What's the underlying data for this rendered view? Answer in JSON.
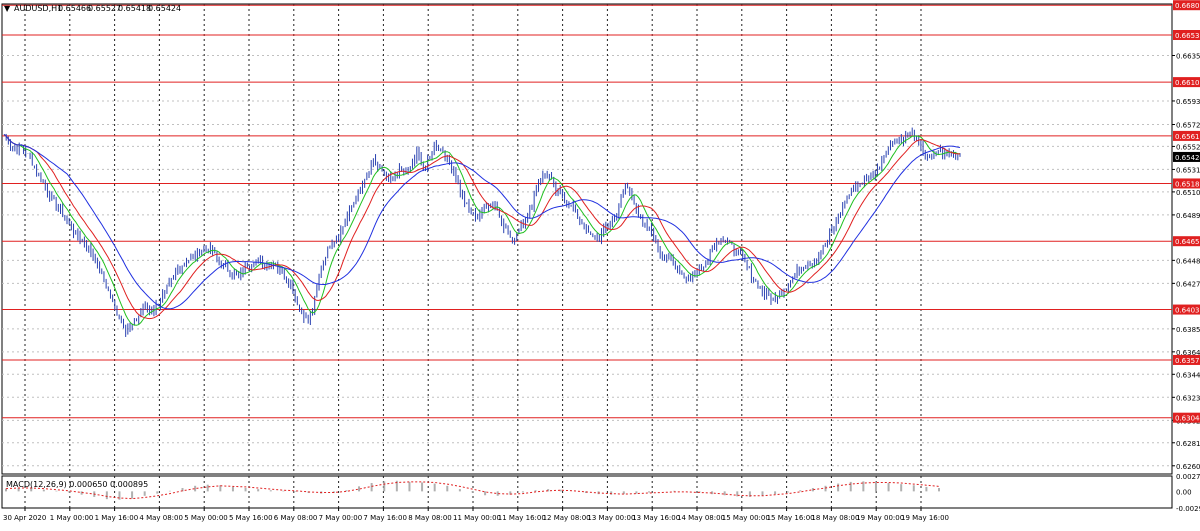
{
  "chart_data": [
    {
      "type": "line",
      "title": "AUDUSD,H1",
      "ohlc": {
        "open": "0.65466",
        "high": "0.65527",
        "low": "0.65418",
        "close": "0.65424"
      },
      "ylim": [
        0.6253,
        0.6682
      ],
      "grid": true,
      "price_ticks": [
        "0.66350",
        "0.65935",
        "0.65720",
        "0.65520",
        "0.65310",
        "0.65105",
        "0.64895",
        "0.64480",
        "0.64270",
        "0.63855",
        "0.63645",
        "0.63440",
        "0.63230",
        "0.63020",
        "0.62815",
        "0.62605"
      ],
      "price_tick_values": [
        0.6635,
        0.65935,
        0.6572,
        0.6552,
        0.6531,
        0.65105,
        0.64895,
        0.6448,
        0.6427,
        0.63855,
        0.63645,
        0.6344,
        0.6323,
        0.6302,
        0.62815,
        0.62605
      ],
      "current_price": {
        "label": "0.65424",
        "value": 0.65424
      },
      "levels": [
        {
          "label": "0.66809",
          "value": 0.66809
        },
        {
          "label": "0.66537",
          "value": 0.66537
        },
        {
          "label": "0.66107",
          "value": 0.66107
        },
        {
          "label": "0.65616",
          "value": 0.65616
        },
        {
          "label": "0.65182",
          "value": 0.65182
        },
        {
          "label": "0.64655",
          "value": 0.64655
        },
        {
          "label": "0.64031",
          "value": 0.64031
        },
        {
          "label": "0.63571",
          "value": 0.63571
        },
        {
          "label": "0.63044",
          "value": 0.63044
        }
      ],
      "x_labels": [
        "30 Apr 2020",
        "1 May 00:00",
        "1 May 16:00",
        "4 May 08:00",
        "5 May 00:00",
        "5 May 16:00",
        "6 May 08:00",
        "7 May 00:00",
        "7 May 16:00",
        "8 May 08:00",
        "11 May 00:00",
        "11 May 16:00",
        "12 May 08:00",
        "13 May 00:00",
        "13 May 16:00",
        "14 May 08:00",
        "15 May 00:00",
        "15 May 16:00",
        "18 May 08:00",
        "19 May 00:00",
        "19 May 16:00"
      ],
      "price_path": [
        [
          0,
          0.6563
        ],
        [
          4,
          0.6549
        ],
        [
          8,
          0.6552
        ],
        [
          12,
          0.6541
        ],
        [
          16,
          0.6525
        ],
        [
          20,
          0.6512
        ],
        [
          24,
          0.6498
        ],
        [
          28,
          0.6488
        ],
        [
          32,
          0.6475
        ],
        [
          36,
          0.6466
        ],
        [
          40,
          0.6456
        ],
        [
          44,
          0.644
        ],
        [
          48,
          0.642
        ],
        [
          52,
          0.64
        ],
        [
          56,
          0.6385
        ],
        [
          60,
          0.639
        ],
        [
          64,
          0.6405
        ],
        [
          68,
          0.6402
        ],
        [
          72,
          0.6412
        ],
        [
          76,
          0.6425
        ],
        [
          80,
          0.644
        ],
        [
          84,
          0.6448
        ],
        [
          88,
          0.6452
        ],
        [
          92,
          0.646
        ],
        [
          96,
          0.6456
        ],
        [
          100,
          0.6445
        ],
        [
          104,
          0.6438
        ],
        [
          108,
          0.6432
        ],
        [
          112,
          0.6443
        ],
        [
          116,
          0.6448
        ],
        [
          120,
          0.6445
        ],
        [
          124,
          0.6446
        ],
        [
          128,
          0.6438
        ],
        [
          132,
          0.6425
        ],
        [
          136,
          0.6405
        ],
        [
          140,
          0.6392
        ],
        [
          142,
          0.6403
        ],
        [
          146,
          0.6442
        ],
        [
          150,
          0.6463
        ],
        [
          154,
          0.647
        ],
        [
          158,
          0.6488
        ],
        [
          162,
          0.6505
        ],
        [
          166,
          0.652
        ],
        [
          170,
          0.6538
        ],
        [
          174,
          0.6528
        ],
        [
          178,
          0.652
        ],
        [
          182,
          0.653
        ],
        [
          186,
          0.6528
        ],
        [
          190,
          0.6545
        ],
        [
          194,
          0.6532
        ],
        [
          198,
          0.6552
        ],
        [
          202,
          0.6548
        ],
        [
          206,
          0.6535
        ],
        [
          210,
          0.6512
        ],
        [
          214,
          0.6492
        ],
        [
          218,
          0.6488
        ],
        [
          222,
          0.6498
        ],
        [
          226,
          0.65
        ],
        [
          230,
          0.648
        ],
        [
          234,
          0.6465
        ],
        [
          238,
          0.6482
        ],
        [
          242,
          0.6492
        ],
        [
          246,
          0.6522
        ],
        [
          250,
          0.6528
        ],
        [
          254,
          0.6512
        ],
        [
          258,
          0.6505
        ],
        [
          262,
          0.6495
        ],
        [
          266,
          0.6482
        ],
        [
          270,
          0.647
        ],
        [
          274,
          0.6468
        ],
        [
          278,
          0.6482
        ],
        [
          282,
          0.649
        ],
        [
          286,
          0.6518
        ],
        [
          290,
          0.6502
        ],
        [
          294,
          0.648
        ],
        [
          298,
          0.6475
        ],
        [
          302,
          0.6455
        ],
        [
          306,
          0.645
        ],
        [
          310,
          0.644
        ],
        [
          314,
          0.6432
        ],
        [
          318,
          0.6436
        ],
        [
          322,
          0.6442
        ],
        [
          326,
          0.646
        ],
        [
          330,
          0.6468
        ],
        [
          334,
          0.6462
        ],
        [
          338,
          0.6455
        ],
        [
          342,
          0.6442
        ],
        [
          346,
          0.6428
        ],
        [
          350,
          0.6418
        ],
        [
          354,
          0.6412
        ],
        [
          358,
          0.642
        ],
        [
          362,
          0.643
        ],
        [
          366,
          0.644
        ],
        [
          370,
          0.6446
        ],
        [
          374,
          0.6448
        ],
        [
          378,
          0.6462
        ],
        [
          382,
          0.648
        ],
        [
          386,
          0.6498
        ],
        [
          390,
          0.6512
        ],
        [
          394,
          0.6518
        ],
        [
          398,
          0.6525
        ],
        [
          402,
          0.653
        ],
        [
          406,
          0.6548
        ],
        [
          410,
          0.6558
        ],
        [
          414,
          0.656
        ],
        [
          418,
          0.6565
        ],
        [
          422,
          0.655
        ],
        [
          426,
          0.654
        ],
        [
          430,
          0.6548
        ],
        [
          434,
          0.6546
        ],
        [
          438,
          0.6545
        ],
        [
          440,
          0.6544
        ]
      ]
    },
    {
      "type": "histogram",
      "title": "MACD(12,26,9) 0.000650 0.000895",
      "ylim": [
        -0.00299,
        0.00276
      ],
      "y_ticks": [
        "0.002762",
        "0.00",
        "-0.00299"
      ],
      "y_tick_values": [
        0.00276,
        0.0,
        -0.00299
      ],
      "series": [
        {
          "type": "bar",
          "values": [
            0.0005,
            0.0007,
            0.0006,
            0.0003,
            0.0001,
            -0.0002,
            -0.0006,
            -0.001,
            -0.0014,
            -0.0015,
            -0.0013,
            -0.0008,
            -0.0004,
            0.0001,
            0.0006,
            0.001,
            0.0012,
            0.0011,
            0.0008,
            0.0006,
            0.0004,
            0.0002,
            0.0001,
            -0.0001,
            -0.0003,
            -0.0004,
            -0.0003,
            0.0002,
            0.0009,
            0.0015,
            0.0018,
            0.0019,
            0.0017,
            0.0016,
            0.0014,
            0.001,
            0.0004,
            -0.0002,
            -0.0007,
            -0.0008,
            -0.0006,
            -0.0002,
            0.0002,
            0.0004,
            0.0003,
            0.0,
            -0.0003,
            -0.0005,
            -0.0006,
            -0.0005,
            -0.0004,
            -0.0002,
            0.0,
            0.0001,
            0.0,
            -0.0002,
            -0.0005,
            -0.0007,
            -0.0009,
            -0.001,
            -0.0008,
            -0.0005,
            -0.0002,
            0.0002,
            0.0006,
            0.001,
            0.0014,
            0.0017,
            0.0018,
            0.0017,
            0.0015,
            0.0013,
            0.0011,
            0.0008,
            0.0006
          ]
        },
        {
          "type": "signal",
          "values": [
            0.0005,
            0.0006,
            0.0006,
            0.0005,
            0.0003,
            0.0001,
            -0.0002,
            -0.0005,
            -0.0009,
            -0.0012,
            -0.0013,
            -0.0011,
            -0.0008,
            -0.0004,
            0.0001,
            0.0005,
            0.0008,
            0.001,
            0.0009,
            0.0008,
            0.0006,
            0.0004,
            0.0002,
            0.0001,
            -0.0001,
            -0.0002,
            -0.0002,
            0.0,
            0.0004,
            0.0009,
            0.0013,
            0.0016,
            0.0017,
            0.0017,
            0.0016,
            0.0013,
            0.0009,
            0.0004,
            -0.0001,
            -0.0004,
            -0.0005,
            -0.0004,
            -0.0001,
            0.0001,
            0.0002,
            0.0001,
            -0.0001,
            -0.0003,
            -0.0004,
            -0.0005,
            -0.0004,
            -0.0003,
            -0.0002,
            -0.0001,
            -0.0001,
            -0.0002,
            -0.0003,
            -0.0005,
            -0.0007,
            -0.0008,
            -0.0008,
            -0.0006,
            -0.0004,
            -0.0001,
            0.0003,
            0.0006,
            0.001,
            0.0013,
            0.0015,
            0.0016,
            0.0016,
            0.0015,
            0.0013,
            0.0011,
            0.0009
          ]
        }
      ]
    }
  ],
  "colors": {
    "background": "#ffffff",
    "grid": "#c0c0c0",
    "vgrid": "#202020",
    "candle": "#2840b0",
    "level": "#e02020",
    "ma_fast": "#20c020",
    "ma_mid": "#e02020",
    "ma_slow": "#2030e0",
    "current_bg": "#000000",
    "current_fg": "#ffffff",
    "text": "#000000",
    "macd_bar": "#b0b0b0",
    "macd_signal": "#e02020"
  }
}
